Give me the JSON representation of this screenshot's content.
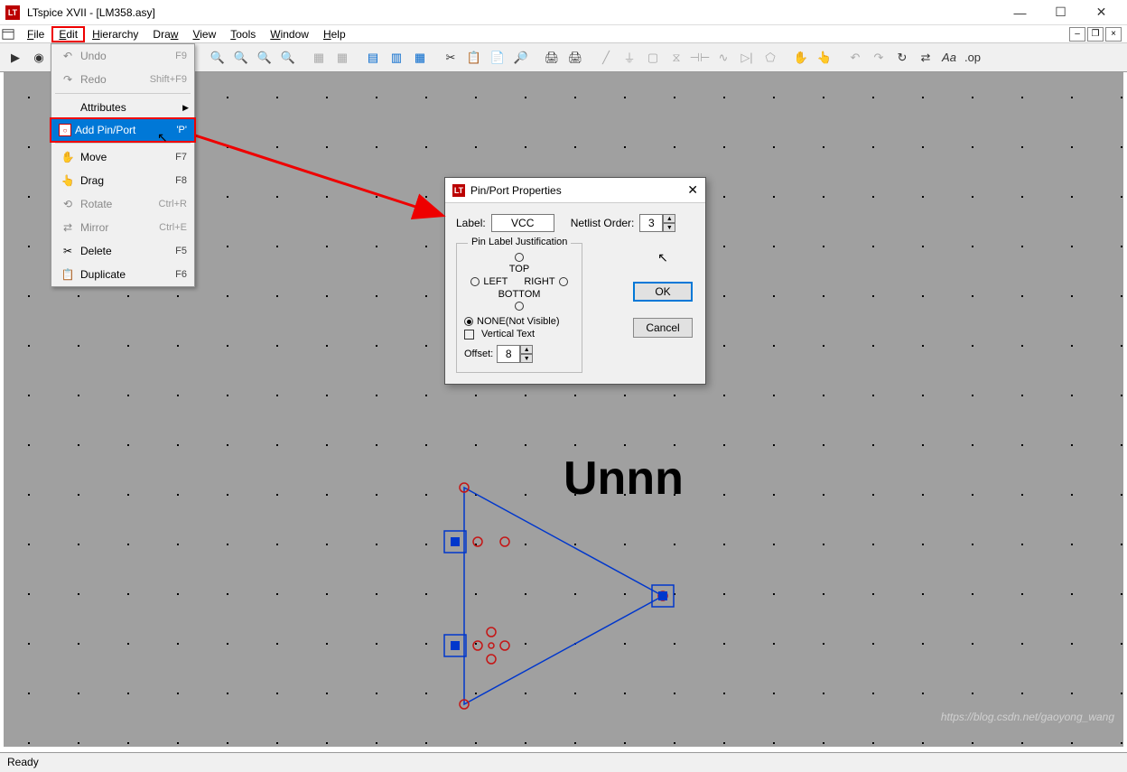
{
  "title": "LTspice XVII - [LM358.asy]",
  "menu": {
    "file": "File",
    "edit": "Edit",
    "hierarchy": "Hierarchy",
    "draw": "Draw",
    "view": "View",
    "tools": "Tools",
    "window": "Window",
    "help": "Help"
  },
  "edit_menu": {
    "undo": {
      "label": "Undo",
      "shortcut": "F9"
    },
    "redo": {
      "label": "Redo",
      "shortcut": "Shift+F9"
    },
    "attributes": {
      "label": "Attributes"
    },
    "add_pin": {
      "label": "Add Pin/Port",
      "shortcut": "'P'"
    },
    "move": {
      "label": "Move",
      "shortcut": "F7"
    },
    "drag": {
      "label": "Drag",
      "shortcut": "F8"
    },
    "rotate": {
      "label": "Rotate",
      "shortcut": "Ctrl+R"
    },
    "mirror": {
      "label": "Mirror",
      "shortcut": "Ctrl+E"
    },
    "delete": {
      "label": "Delete",
      "shortcut": "F5"
    },
    "duplicate": {
      "label": "Duplicate",
      "shortcut": "F6"
    }
  },
  "dialog": {
    "title": "Pin/Port Properties",
    "label_text": "Label:",
    "label_value": "VCC",
    "netlist_order_text": "Netlist Order:",
    "netlist_order_value": "3",
    "group_title": "Pin Label Justification",
    "top": "TOP",
    "left": "LEFT",
    "right": "RIGHT",
    "bottom": "BOTTOM",
    "none": "NONE(Not Visible)",
    "vertical": "Vertical Text",
    "offset_label": "Offset:",
    "offset_value": "8",
    "ok": "OK",
    "cancel": "Cancel"
  },
  "symbol_text": "Unnn",
  "status": "Ready",
  "watermark": "https://blog.csdn.net/gaoyong_wang"
}
